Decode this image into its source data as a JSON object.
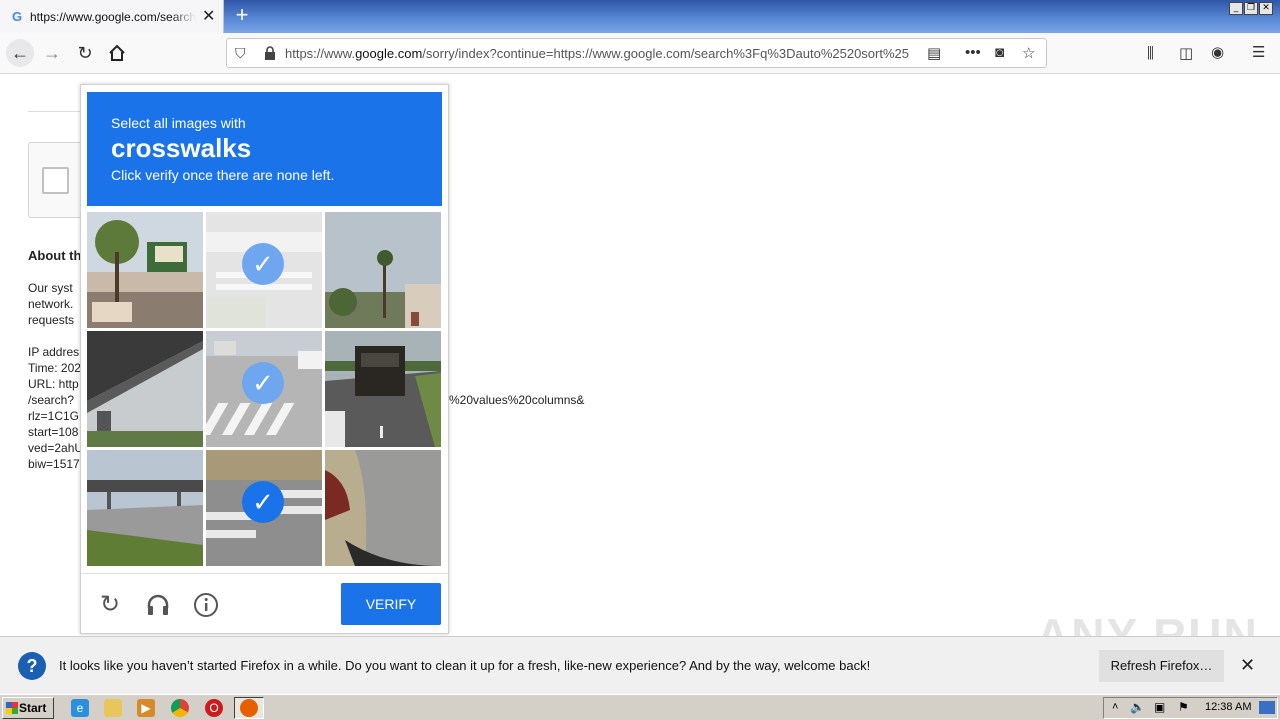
{
  "browser": {
    "tab_title": "https://www.google.com/search?q",
    "new_tab": "+",
    "url_prefix": "https://www.",
    "url_domain": "google.com",
    "url_rest": "/sorry/index?continue=https://www.google.com/search%3Fq%3Dauto%2520sort%25",
    "window_buttons": [
      "_",
      "❐",
      "✕"
    ]
  },
  "page": {
    "about_heading": "About th",
    "para_lines": [
      "Our syst",
      "network.",
      "requests"
    ],
    "info_lines": [
      "IP addres",
      "Time: 202",
      "URL: http",
      "/search?",
      "rlz=1C1G",
      "start=108",
      "ved=2ahU",
      "biw=1517"
    ],
    "url_tail": "%20values%20columns&"
  },
  "captcha": {
    "line1": "Select all images with",
    "target": "crosswalks",
    "line3": "Click verify once there are none left.",
    "verify_label": "VERIFY",
    "tiles": [
      {
        "scene": "street-storefronts",
        "selected": false
      },
      {
        "scene": "crosswalk-faded",
        "selected": true
      },
      {
        "scene": "palm-tree-road",
        "selected": false
      },
      {
        "scene": "overpass",
        "selected": false
      },
      {
        "scene": "crosswalk-intersection",
        "selected": true
      },
      {
        "scene": "truck-highway",
        "selected": false
      },
      {
        "scene": "bridge-grass",
        "selected": false
      },
      {
        "scene": "crosswalk-stripes",
        "selected": true
      },
      {
        "scene": "car-closeup",
        "selected": false
      }
    ]
  },
  "notification": {
    "message": "It looks like you haven’t started Firefox in a while. Do you want to clean it up for a fresh, like-new experience? And by the way, welcome back!",
    "refresh_label": "Refresh Firefox…"
  },
  "watermark": "ANY RUN",
  "taskbar": {
    "start_label": "Start",
    "clock": "12:38 AM"
  }
}
